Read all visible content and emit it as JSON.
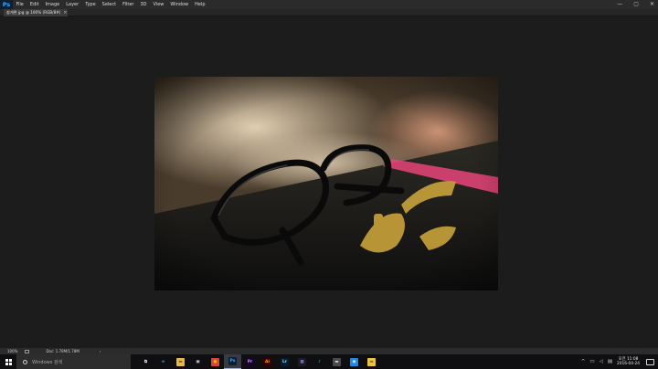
{
  "app": {
    "logo": "Ps",
    "menu": [
      "File",
      "Edit",
      "Image",
      "Layer",
      "Type",
      "Select",
      "Filter",
      "3D",
      "View",
      "Window",
      "Help"
    ],
    "window_controls": [
      "—",
      "▢",
      "✕"
    ]
  },
  "document_tab": {
    "label": "참게편 jpg @ 100% (RGB/8#)",
    "close": "×"
  },
  "status_bar": {
    "zoom": "100%",
    "doc_info": "Doc: 1.78M/1.78M",
    "arrow": "›"
  },
  "taskbar": {
    "search_placeholder": "Windows 검색",
    "apps": [
      {
        "name": "task-view",
        "glyph": "⧉",
        "bg": "#0f0f12",
        "fg": "#d8d8d8"
      },
      {
        "name": "edge",
        "glyph": "e",
        "bg": "#0f0f12",
        "fg": "#3b8ee0"
      },
      {
        "name": "file-explorer",
        "glyph": "▬",
        "bg": "#e8b84a",
        "fg": "#7a5512"
      },
      {
        "name": "store",
        "glyph": "▣",
        "bg": "#0f0f12",
        "fg": "#d8d8d8"
      },
      {
        "name": "chrome",
        "glyph": "●",
        "bg": "#db4437",
        "fg": "#f4c20d"
      },
      {
        "name": "photoshop",
        "glyph": "Ps",
        "bg": "#0c1f33",
        "fg": "#31a8ff"
      },
      {
        "name": "premiere",
        "glyph": "Pr",
        "bg": "#1a0033",
        "fg": "#d58aff"
      },
      {
        "name": "illustrator",
        "glyph": "Ai",
        "bg": "#330000",
        "fg": "#ff9a00"
      },
      {
        "name": "lightroom",
        "glyph": "Lr",
        "bg": "#001e36",
        "fg": "#add5ec"
      },
      {
        "name": "media-encoder",
        "glyph": "▦",
        "bg": "#1b1b26",
        "fg": "#9999ff"
      },
      {
        "name": "music",
        "glyph": "♪",
        "bg": "#0f0f12",
        "fg": "#4fc3f7"
      },
      {
        "name": "kakaotalk",
        "glyph": "▬",
        "bg": "#4a4a4a",
        "fg": "#d8d8d8"
      },
      {
        "name": "browser",
        "glyph": "◉",
        "bg": "#1e88e5",
        "fg": "#ffffff"
      },
      {
        "name": "folder",
        "glyph": "▬",
        "bg": "#e8c44a",
        "fg": "#8a6a12"
      }
    ],
    "tray": {
      "chevron": "^",
      "clock_time": "오전 11:08",
      "clock_date": "2016-04-24"
    }
  }
}
